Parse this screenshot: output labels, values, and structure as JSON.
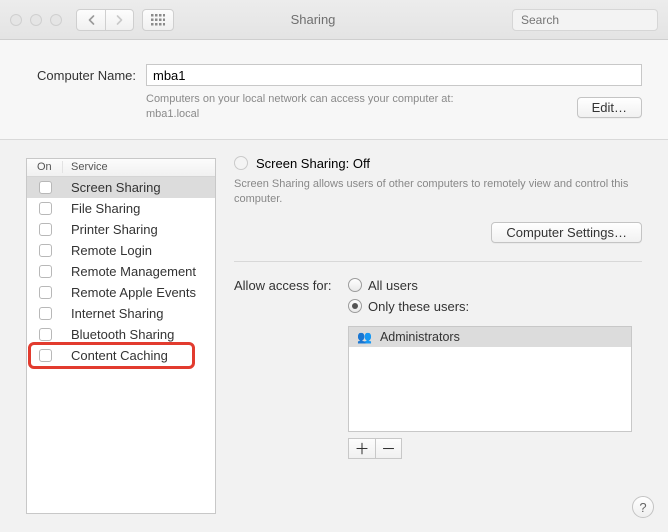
{
  "window": {
    "title": "Sharing",
    "search_placeholder": "Search"
  },
  "computer_name": {
    "label": "Computer Name:",
    "value": "mba1",
    "note_line1": "Computers on your local network can access your computer at:",
    "note_line2": "mba1.local",
    "edit_label": "Edit…"
  },
  "services": {
    "col_on": "On",
    "col_service": "Service",
    "items": [
      {
        "label": "Screen Sharing",
        "checked": false,
        "selected": true
      },
      {
        "label": "File Sharing",
        "checked": false,
        "selected": false
      },
      {
        "label": "Printer Sharing",
        "checked": false,
        "selected": false
      },
      {
        "label": "Remote Login",
        "checked": false,
        "selected": false
      },
      {
        "label": "Remote Management",
        "checked": false,
        "selected": false
      },
      {
        "label": "Remote Apple Events",
        "checked": false,
        "selected": false
      },
      {
        "label": "Internet Sharing",
        "checked": false,
        "selected": false
      },
      {
        "label": "Bluetooth Sharing",
        "checked": false,
        "selected": false
      },
      {
        "label": "Content Caching",
        "checked": false,
        "selected": false
      }
    ],
    "highlighted_index": 8
  },
  "detail": {
    "status_title": "Screen Sharing: Off",
    "status_desc": "Screen Sharing allows users of other computers to remotely view and control this computer.",
    "computer_settings_label": "Computer Settings…",
    "access_label": "Allow access for:",
    "access_options": [
      {
        "label": "All users",
        "selected": false
      },
      {
        "label": "Only these users:",
        "selected": true
      }
    ],
    "users": [
      {
        "label": "Administrators"
      }
    ],
    "plus": "＋",
    "minus": "－"
  },
  "help": "?"
}
